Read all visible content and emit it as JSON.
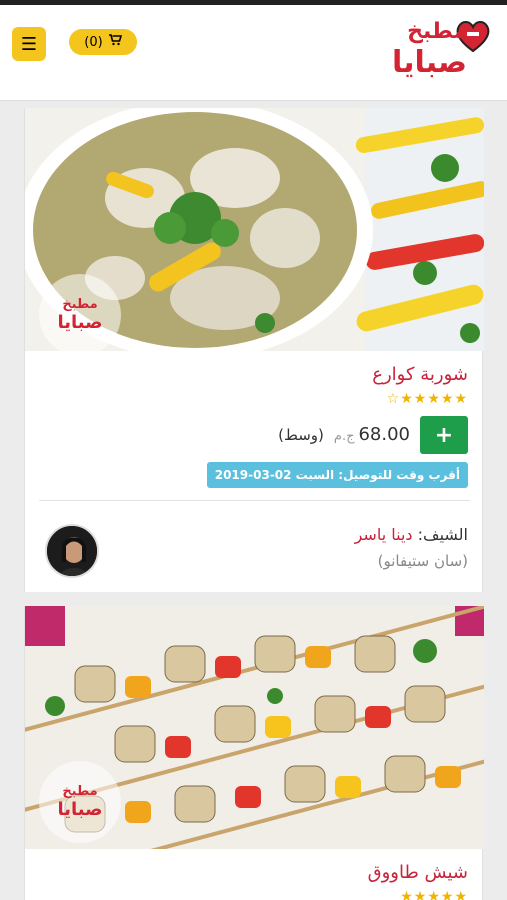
{
  "header": {
    "menu_icon": "hamburger-icon",
    "cart_count": "(0)",
    "cart_icon": "cart-icon",
    "logo_line1": "مطبخ",
    "logo_line2": "صبايا"
  },
  "colors": {
    "accent_yellow": "#f4c51c",
    "brand_red": "#d32434",
    "add_green": "#1e9e4a",
    "delivery_blue": "#5bc0de"
  },
  "items": [
    {
      "title": "شوربة كوارع",
      "rating": 5,
      "add_label": "+",
      "price": "68.00",
      "currency": "ج.م",
      "size": "(وسط)",
      "delivery": "أقرب وقت للتوصيل: السبت 02-03-2019",
      "chef_label": "الشيف:",
      "chef_name": "دينا ياسر",
      "chef_place": "(سان ستيفانو)",
      "watermark_line1": "مطبخ",
      "watermark_line2": "صبايا"
    },
    {
      "title": "شيش طاووق",
      "rating": 5,
      "watermark_line1": "مطبخ",
      "watermark_line2": "صبايا"
    }
  ]
}
